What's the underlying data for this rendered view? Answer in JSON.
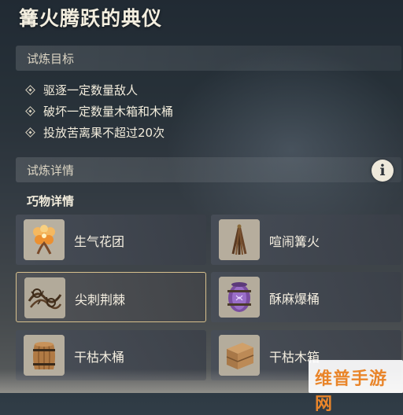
{
  "title": "篝火腾跃的典仪",
  "objectives": {
    "header": "试炼目标",
    "items": [
      "驱逐一定数量敌人",
      "破坏一定数量木箱和木桶",
      "投放苦离果不超过20次"
    ]
  },
  "details": {
    "header": "试炼详情",
    "info_icon": "info-icon",
    "subheading": "巧物详情",
    "items": [
      {
        "name": "生气花团",
        "icon": "flower-cluster-icon",
        "selected": false
      },
      {
        "name": "喧闹篝火",
        "icon": "bonfire-icon",
        "selected": false
      },
      {
        "name": "尖刺荆棘",
        "icon": "thorn-bramble-icon",
        "selected": true
      },
      {
        "name": "酥麻爆桶",
        "icon": "explosive-barrel-icon",
        "selected": false
      },
      {
        "name": "干枯木桶",
        "icon": "wooden-barrel-icon",
        "selected": false
      },
      {
        "name": "干枯木箱",
        "icon": "wooden-crate-icon",
        "selected": false
      }
    ]
  },
  "watermark": "维普手游网",
  "colors": {
    "accent_border": "#d7c08d",
    "watermark_text": "#e9852a"
  }
}
